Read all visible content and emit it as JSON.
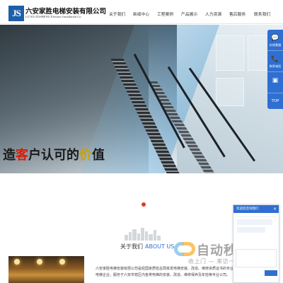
{
  "header": {
    "logo_mark": "JS",
    "company_cn": "六安家胜电梯安装有限公司",
    "company_en": "LU'AN JIASHENG Elevator Installation Co.",
    "nav": [
      "关于我们",
      "新闻中心",
      "工程案例",
      "产品展示",
      "人力资源",
      "售后服务",
      "联系我们"
    ]
  },
  "banner": {
    "slogan_part1": "造",
    "slogan_hl1": "客",
    "slogan_part2": "户认可的",
    "slogan_hl2": "价",
    "slogan_part3": "值"
  },
  "side_bar": {
    "items": [
      {
        "icon": "chat-icon",
        "glyph": "💬",
        "label": "在线客服"
      },
      {
        "icon": "phone-icon",
        "glyph": "📞",
        "label": "联系电话"
      },
      {
        "icon": "wechat-icon",
        "glyph": "▣",
        "label": ""
      }
    ],
    "top_label": "TOP"
  },
  "about": {
    "title_cn": "关于我们",
    "title_en": "ABOUT US",
    "text": "六安家胜电梯安装有限公司是经国家质检总局核发电梯安装、改造、维修资质证书的专业化电梯企业，服务于六安市辖区内各类电梯的安装、改造、维修保养及年检等专业公司。"
  },
  "chat": {
    "title": "欢迎您咨询我们",
    "close": "×"
  },
  "watermark": {
    "brand": "自动秒收录",
    "tagline": "收上门 — 来访一次 — 自动收录"
  },
  "colors": {
    "primary": "#2f6fd1",
    "accent_red": "#d81e06",
    "accent_gold": "#c9a300",
    "dot": "#e5391c"
  }
}
